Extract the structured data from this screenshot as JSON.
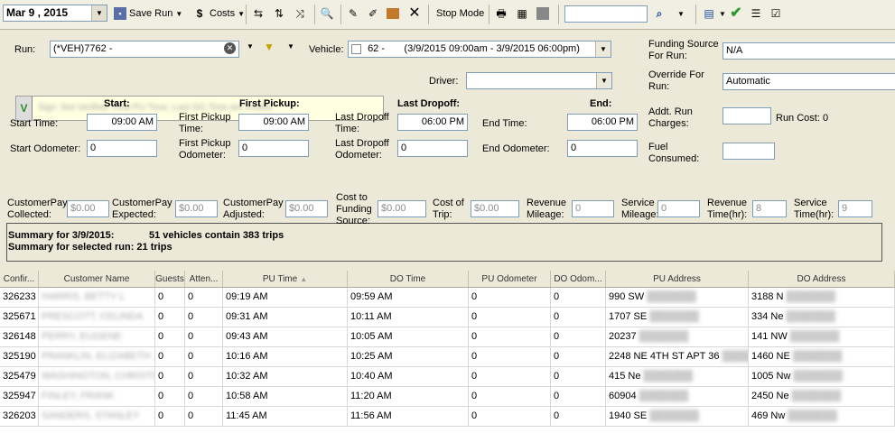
{
  "toolbar": {
    "date": "Mar  9 , 2015",
    "save_run": "Save Run",
    "costs": "Costs",
    "stop_mode": "Stop Mode"
  },
  "run": {
    "run_label": "Run:",
    "run_value": "(*VEH)7762 - ",
    "vehicle_label": "Vehicle:",
    "vehicle_value": "62 - ",
    "vehicle_time": "(3/9/2015 09:00am - 3/9/2015 06:00pm)",
    "funding_source_label": "Funding Source For Run:",
    "funding_source_value": "N/A",
    "override_label": "Override For Run:",
    "override_value": "Automatic",
    "driver_label": "Driver:",
    "driver_value": "",
    "note_prefix": "V",
    "note_text": "Sign: Not Verified. First PU Time, Last DO Time are invalid."
  },
  "sections": {
    "start_title": "Start:",
    "first_pickup_title": "First Pickup:",
    "last_dropoff_title": "Last Dropoff:",
    "end_title": "End:"
  },
  "fields": {
    "start_time_label": "Start Time:",
    "start_time": "09:00 AM",
    "start_odo_label": "Start Odometer:",
    "start_odo": "0",
    "first_pickup_time_label": "First Pickup Time:",
    "first_pickup_time": "09:00 AM",
    "first_pickup_odo_label": "First Pickup Odometer:",
    "first_pickup_odo": "0",
    "last_dropoff_time_label": "Last Dropoff Time:",
    "last_dropoff_time": "06:00 PM",
    "last_dropoff_odo_label": "Last Dropoff Odometer:",
    "last_dropoff_odo": "0",
    "end_time_label": "End Time:",
    "end_time": "06:00 PM",
    "end_odo_label": "End Odometer:",
    "end_odo": "0",
    "addt_charges_label": "Addt. Run Charges:",
    "addt_charges": "",
    "run_cost_label": "Run Cost: 0",
    "fuel_label": "Fuel Consumed:",
    "fuel": ""
  },
  "finance": {
    "cp_collected_label": "CustomerPay Collected:",
    "cp_collected": "$0.00",
    "cp_expected_label": "CustomerPay Expected:",
    "cp_expected": "$0.00",
    "cp_adjusted_label": "CustomerPay Adjusted:",
    "cp_adjusted": "$0.00",
    "cost_to_fs_label": "Cost to Funding Source:",
    "cost_to_fs": "$0.00",
    "cost_of_trip_label": "Cost of Trip:",
    "cost_of_trip": "$0.00",
    "revenue_mileage_label": "Revenue Mileage:",
    "revenue_mileage": "0",
    "service_mileage_label": "Service Mileage:",
    "service_mileage": "0",
    "revenue_time_label": "Revenue Time(hr):",
    "revenue_time": "8",
    "service_time_label": "Service Time(hr):",
    "service_time": "9"
  },
  "summary": {
    "date_line_label": "Summary for 3/9/2015:",
    "date_line_value": "51 vehicles contain 383 trips",
    "run_line": "Summary for selected run: 21 trips"
  },
  "grid": {
    "columns": [
      "Confir...",
      "Customer Name",
      "Guests",
      "Atten...",
      "PU Time",
      "DO Time",
      "PU Odometer",
      "DO Odom...",
      "PU Address",
      "DO Address"
    ],
    "rows": [
      [
        "326233",
        "HARRIS, BETTY L",
        "0",
        "0",
        "09:19 AM",
        "09:59 AM",
        "0",
        "0",
        "990 SW",
        "3188 N"
      ],
      [
        "325671",
        "PRESCOTT, CELINDA",
        "0",
        "0",
        "09:31 AM",
        "10:11 AM",
        "0",
        "0",
        "1707 SE",
        "334 Ne"
      ],
      [
        "326148",
        "PERRY, EUGENE",
        "0",
        "0",
        "09:43 AM",
        "10:05 AM",
        "0",
        "0",
        "20237",
        "141 NW"
      ],
      [
        "325190",
        "FRANKLIN, ELIZABETH",
        "0",
        "0",
        "10:16 AM",
        "10:25 AM",
        "0",
        "0",
        "2248 NE 4TH ST APT 36",
        "1460 NE"
      ],
      [
        "325479",
        "WASHINGTON, CHRISTOPHER",
        "0",
        "0",
        "10:32 AM",
        "10:40 AM",
        "0",
        "0",
        "415 Ne",
        "1005 Nw"
      ],
      [
        "325947",
        "FINLEY, FRANK",
        "0",
        "0",
        "10:58 AM",
        "11:20 AM",
        "0",
        "0",
        "60904",
        "2450 Ne"
      ],
      [
        "326203",
        "SANDERS, STANLEY",
        "0",
        "0",
        "11:45 AM",
        "11:56 AM",
        "0",
        "0",
        "1940 SE",
        "469 Nw"
      ]
    ],
    "sort_indicator": "▲"
  }
}
